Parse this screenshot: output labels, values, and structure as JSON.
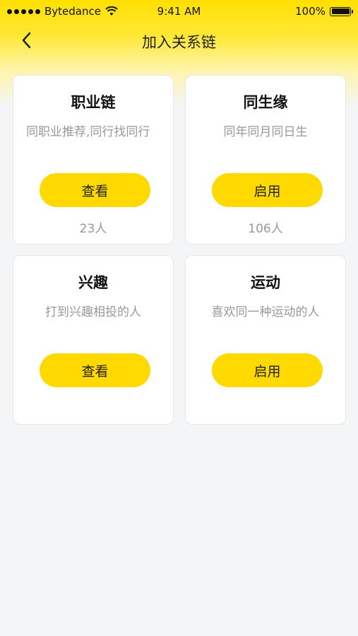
{
  "status_bar": {
    "carrier": "Bytedance",
    "time": "9:41 AM",
    "battery": "100%",
    "battery_level": 1.0
  },
  "header": {
    "title": "加入关系链",
    "back_icon": "chevron-left-icon"
  },
  "cards": [
    {
      "title": "职业链",
      "description": "同职业推荐,同行找同行",
      "button": "查看",
      "count": "23人"
    },
    {
      "title": "同生缘",
      "description": "同年同月同日生",
      "button": "启用",
      "count": "106人"
    },
    {
      "title": "兴趣",
      "description": "打到兴趣相投的人",
      "button": "查看",
      "count": ""
    },
    {
      "title": "运动",
      "description": "喜欢同一种运动的人",
      "button": "启用",
      "count": ""
    }
  ],
  "colors": {
    "accent": "#ffd900",
    "header_gradient": "#ffe000",
    "background": "#f4f5f7"
  }
}
